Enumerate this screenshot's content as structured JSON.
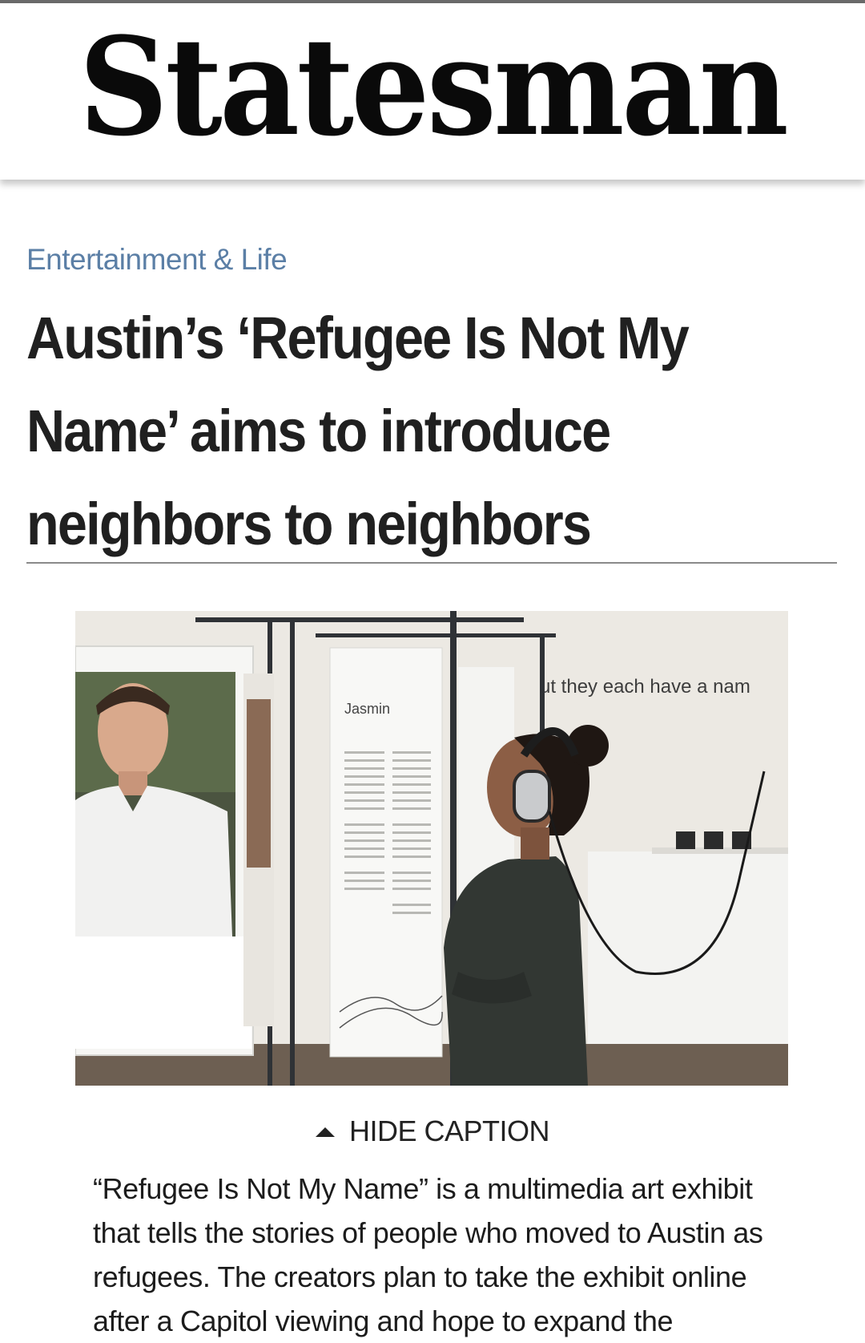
{
  "masthead": {
    "logo_text": "Statesman"
  },
  "article": {
    "section": "Entertainment & Life",
    "headline": "Austin’s ‘Refugee Is Not My Name’ aims to introduce neighbors to neighbors"
  },
  "photo": {
    "panel_name": "Jasmin",
    "wall_text": "ut they each have a nam"
  },
  "caption": {
    "toggle_label": "HIDE CAPTION",
    "text": "“Refugee Is Not My Name” is a multimedia art exhibit that tells the stories of people who moved to Austin as refugees. The creators plan to take the exhibit online after a Capitol viewing and hope to expand the"
  },
  "colors": {
    "section_link": "#5b7fa6",
    "headline": "#202020",
    "rule": "#8a8a8a"
  }
}
